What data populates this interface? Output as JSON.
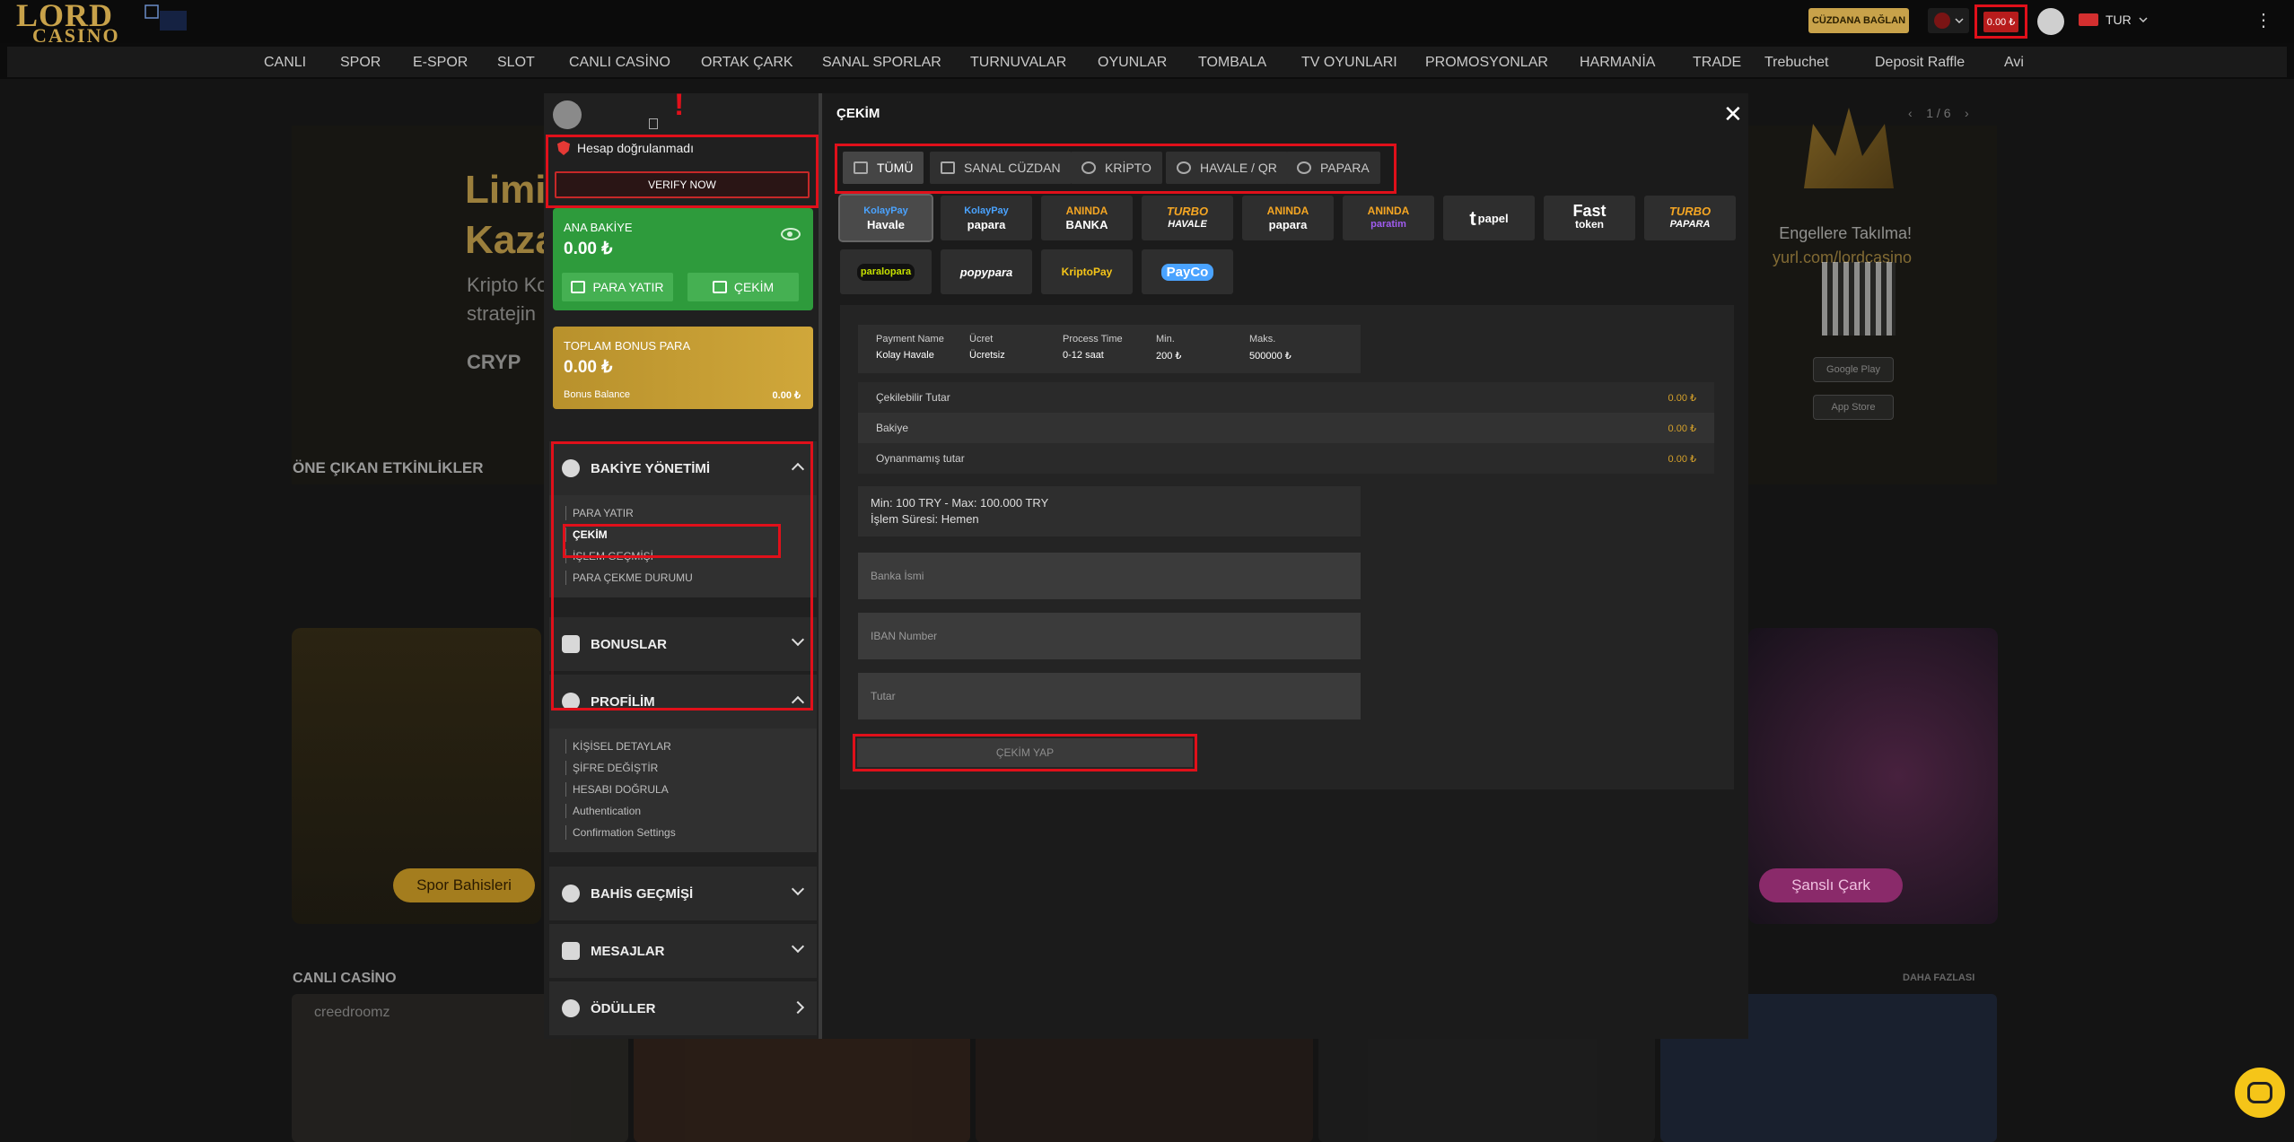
{
  "topbar": {
    "logo_text": "LORD",
    "logo_sub": "CASINO",
    "wallet_button": "CÜZDANA BAĞLAN",
    "balance": "0.00 ₺",
    "language": "TUR",
    "kebab": "⋮"
  },
  "nav": [
    "CANLI",
    "SPOR",
    "E-SPOR",
    "SLOT",
    "CANLI CASİNO",
    "ORTAK ÇARK",
    "SANAL SPORLAR",
    "TURNUVALAR",
    "OYUNLAR",
    "TOMBALA",
    "TV OYUNLARI",
    "PROMOSYONLAR",
    "HARMANİA",
    "TRADE",
    "Trebuchet",
    "Deposit Raffle",
    "Avi"
  ],
  "background": {
    "hero_line1": "Limi",
    "hero_line2": "Kaza",
    "hero_sub1": "Kripto Ko",
    "hero_sub2": "stratejin",
    "hero_brand": "CRYP",
    "pager": "1 / 6",
    "promo_line1": "Engellere Takılma!",
    "promo_line2": "yurl.com/lordcasino",
    "store1": "Google Play",
    "store2": "App Store",
    "featured_title": "ÖNE ÇIKAN ETKİNLİKLER",
    "sports_button": "Spor Bahisleri",
    "wheel_button": "Şanslı Çark",
    "live_casino_title": "CANLI CASİNO",
    "more_link": "DAHA FAZLASI",
    "creedroomz": "creedroomz"
  },
  "sidebar": {
    "verify_status": "Hesap doğrulanmadı",
    "verify_button": "VERIFY NOW",
    "main_balance_label": "ANA BAKİYE",
    "main_balance_value": "0.00 ₺",
    "deposit_button": "PARA YATIR",
    "withdraw_button": "ÇEKİM",
    "bonus_label": "TOPLAM BONUS PARA",
    "bonus_value": "0.00 ₺",
    "bonus_balance_label": "Bonus Balance",
    "bonus_balance_value": "0.00 ₺",
    "balance_mgmt": "BAKİYE YÖNETİMİ",
    "balance_items": [
      "PARA YATIR",
      "ÇEKİM",
      "İŞLEM GEÇMİŞİ",
      "PARA ÇEKME DURUMU"
    ],
    "bonuses": "BONUSLAR",
    "profile": "PROFİLİM",
    "profile_items": [
      "KİŞİSEL DETAYLAR",
      "ŞİFRE DEĞİŞTİR",
      "HESABI DOĞRULA",
      "Authentication",
      "Confirmation Settings"
    ],
    "bet_history": "BAHİS GEÇMİŞİ",
    "messages": "MESAJLAR",
    "rewards": "ÖDÜLLER"
  },
  "main": {
    "title": "ÇEKİM",
    "close": "✕",
    "tabs": [
      "TÜMÜ",
      "SANAL CÜZDAN",
      "KRİPTO",
      "HAVALE / QR",
      "PAPARA"
    ],
    "methods": [
      {
        "label1": "KolayPay",
        "label2": "Havale",
        "color": "#ffffff"
      },
      {
        "label1": "KolayPay",
        "label2": "papara",
        "color": "#ffffff"
      },
      {
        "label1": "ANINDA",
        "label2": "BANKA",
        "color": "#f5a623"
      },
      {
        "label1": "TURBO",
        "label2": "HAVALE",
        "color": "#f5a623"
      },
      {
        "label1": "ANINDA",
        "label2": "papara",
        "color": "#f5a623"
      },
      {
        "label1": "ANINDA",
        "label2": "paratim",
        "color": "#f5a623"
      },
      {
        "label1": "t",
        "label2": "papel",
        "color": "#ffffff"
      },
      {
        "label1": "Fast",
        "label2": "token",
        "color": "#ffffff"
      },
      {
        "label1": "TURBO",
        "label2": "PAPARA",
        "color": "#f5a623"
      },
      {
        "label1": "paralopara",
        "label2": "",
        "color": "#c6e000"
      },
      {
        "label1": "popypara",
        "label2": "",
        "color": "#ffffff"
      },
      {
        "label1": "KriptoPay",
        "label2": "",
        "color": "#f5c518"
      },
      {
        "label1": "PayCo",
        "label2": "",
        "color": "#4aa3ff"
      }
    ],
    "info": {
      "h_name": "Payment Name",
      "v_name": "Kolay Havale",
      "h_fee": "Ücret",
      "v_fee": "Ücretsiz",
      "h_time": "Process Time",
      "v_time": "0-12 saat",
      "h_min": "Min.",
      "v_min": "200 ₺",
      "h_max": "Maks.",
      "v_max": "500000 ₺"
    },
    "balances": [
      {
        "label": "Çekilebilir Tutar",
        "value": "0.00 ₺"
      },
      {
        "label": "Bakiye",
        "value": "0.00 ₺"
      },
      {
        "label": "Oynanmamış tutar",
        "value": "0.00 ₺"
      }
    ],
    "minmax_line1": "Min: 100 TRY - Max: 100.000 TRY",
    "minmax_line2": "İşlem Süresi: Hemen",
    "bank_placeholder": "Banka İsmi",
    "iban_placeholder": "IBAN Number",
    "amount_placeholder": "Tutar",
    "submit": "ÇEKİM YAP"
  }
}
